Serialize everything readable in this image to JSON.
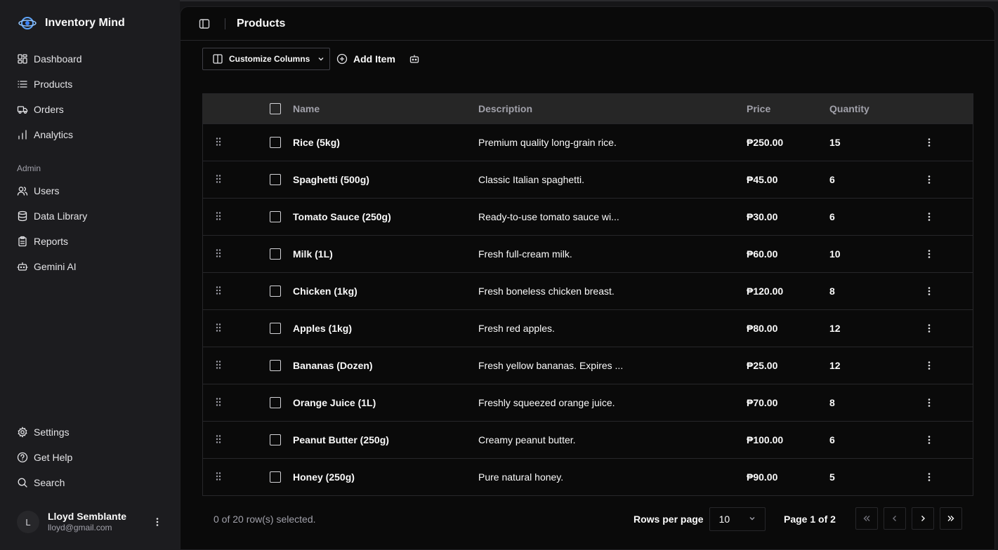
{
  "app": {
    "name": "Inventory Mind"
  },
  "sidebar": {
    "main_items": [
      {
        "label": "Dashboard",
        "icon": "dashboard-icon"
      },
      {
        "label": "Products",
        "icon": "list-icon"
      },
      {
        "label": "Orders",
        "icon": "truck-icon"
      },
      {
        "label": "Analytics",
        "icon": "chart-icon"
      }
    ],
    "admin_heading": "Admin",
    "admin_items": [
      {
        "label": "Users",
        "icon": "users-icon"
      },
      {
        "label": "Data Library",
        "icon": "database-icon"
      },
      {
        "label": "Reports",
        "icon": "clipboard-icon"
      },
      {
        "label": "Gemini AI",
        "icon": "bot-icon"
      }
    ],
    "bottom_items": [
      {
        "label": "Settings",
        "icon": "gear-icon"
      },
      {
        "label": "Get Help",
        "icon": "help-icon"
      },
      {
        "label": "Search",
        "icon": "search-icon"
      }
    ],
    "user": {
      "initial": "L",
      "name": "Lloyd Semblante",
      "email": "lloyd@gmail.com"
    }
  },
  "header": {
    "title": "Products"
  },
  "toolbar": {
    "customize_label": "Customize Columns",
    "add_label": "Add Item"
  },
  "table": {
    "columns": [
      "Name",
      "Description",
      "Price",
      "Quantity"
    ],
    "rows": [
      {
        "name": "Rice (5kg)",
        "description": "Premium quality long-grain rice.",
        "price": "₱250.00",
        "quantity": "15"
      },
      {
        "name": "Spaghetti (500g)",
        "description": "Classic Italian spaghetti.",
        "price": "₱45.00",
        "quantity": "6"
      },
      {
        "name": "Tomato Sauce (250g)",
        "description": "Ready-to-use tomato sauce wi...",
        "price": "₱30.00",
        "quantity": "6"
      },
      {
        "name": "Milk (1L)",
        "description": "Fresh full-cream milk.",
        "price": "₱60.00",
        "quantity": "10"
      },
      {
        "name": "Chicken (1kg)",
        "description": "Fresh boneless chicken breast.",
        "price": "₱120.00",
        "quantity": "8"
      },
      {
        "name": "Apples (1kg)",
        "description": "Fresh red apples.",
        "price": "₱80.00",
        "quantity": "12"
      },
      {
        "name": "Bananas (Dozen)",
        "description": "Fresh yellow bananas. Expires ...",
        "price": "₱25.00",
        "quantity": "12"
      },
      {
        "name": "Orange Juice (1L)",
        "description": "Freshly squeezed orange juice.",
        "price": "₱70.00",
        "quantity": "8"
      },
      {
        "name": "Peanut Butter (250g)",
        "description": "Creamy peanut butter.",
        "price": "₱100.00",
        "quantity": "6"
      },
      {
        "name": "Honey (250g)",
        "description": "Pure natural honey.",
        "price": "₱90.00",
        "quantity": "5"
      }
    ]
  },
  "footer": {
    "selection_text": "0 of 20 row(s) selected.",
    "rows_per_page_label": "Rows per page",
    "rows_per_page_value": "10",
    "page_info": "Page 1 of 2"
  }
}
